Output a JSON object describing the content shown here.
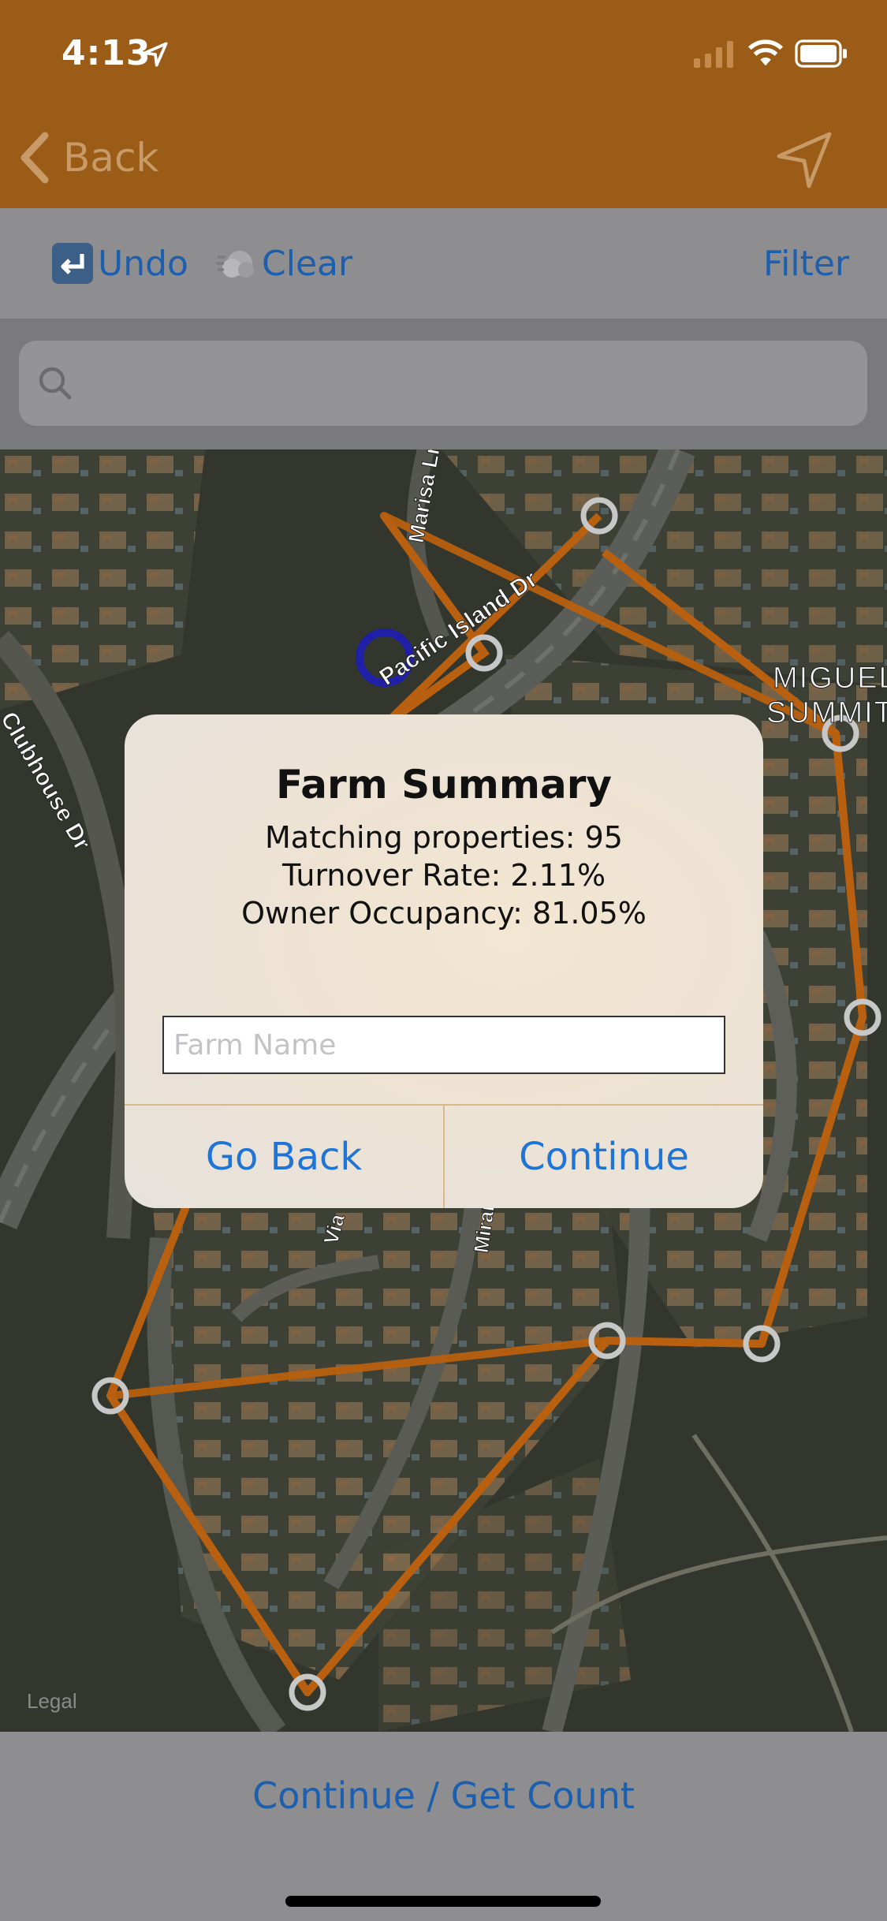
{
  "status_bar": {
    "time": "4:13"
  },
  "nav": {
    "back_label": "Back"
  },
  "toolbar": {
    "undo_label": "Undo",
    "clear_label": "Clear",
    "filter_label": "Filter"
  },
  "search": {
    "placeholder": ""
  },
  "map": {
    "street_labels": [
      "Pacific Island Dr",
      "Clubhouse Dr",
      "Marisa Ln",
      "MIGUEL",
      "SUMMIT",
      "Via",
      "Miran"
    ],
    "legal_label": "Legal",
    "boundary_color": "#b8600f"
  },
  "alert": {
    "title": "Farm Summary",
    "matching_properties": "Matching properties: 95",
    "turnover_rate": "Turnover Rate: 2.11%",
    "owner_occupancy": "Owner Occupancy: 81.05%",
    "input_placeholder": "Farm Name",
    "go_back_label": "Go Back",
    "continue_label": "Continue"
  },
  "bottom_bar": {
    "action_label": "Continue / Get Count"
  },
  "colors": {
    "nav_bg": "#9a5c16",
    "link_blue": "#1f74d8"
  }
}
